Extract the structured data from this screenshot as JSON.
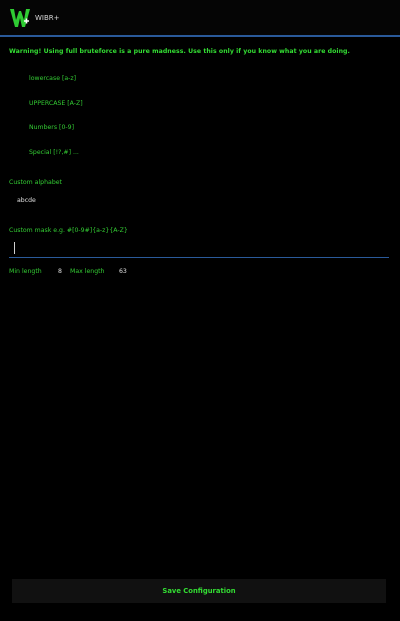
{
  "header": {
    "app_title": "WIBR+",
    "logo_icon": "wibr-logo-icon"
  },
  "warning": "Warning! Using full bruteforce is a pure madness. Use this only if you know what you are doing.",
  "charsets": [
    "lowercase [a-z]",
    "UPPERCASE [A-Z]",
    "Numbers [0-9]",
    "Special [!?,#] ..."
  ],
  "custom_alphabet": {
    "label": "Custom alphabet",
    "value": "abcde"
  },
  "custom_mask": {
    "label": "Custom mask e.g. #[0-9#]{a-z}{A-Z}",
    "value": ""
  },
  "length": {
    "min_label": "Min length",
    "min_value": "8",
    "max_label": "Max length",
    "max_value": "63"
  },
  "save_button": "Save Configuration",
  "colors": {
    "background": "#000000",
    "accent_text": "#33cc33",
    "divider": "#2a5a9a"
  }
}
